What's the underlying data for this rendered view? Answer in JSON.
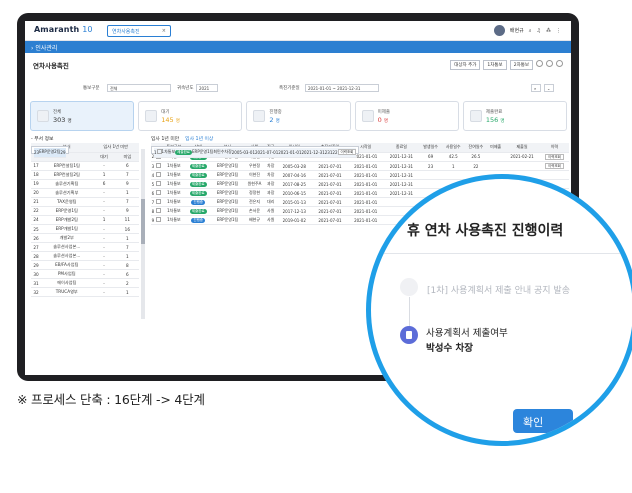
{
  "app": {
    "logo": "Amaranth",
    "version": "10",
    "open_tab": "연차사용촉진",
    "user_name": "배현규"
  },
  "nav": {
    "section": "인사관리"
  },
  "page": {
    "title": "연차사용촉진",
    "buttons": [
      "대상자 추가",
      "1차통보",
      "2차통보"
    ]
  },
  "filter": {
    "org_label": "통보구분",
    "org_value": "전체",
    "year_label": "귀속년도",
    "year_value": "2021",
    "period_label": "촉진기준일",
    "period_value": "2021-01-01 ~ 2021-12-31"
  },
  "cards": [
    {
      "label": "전체",
      "value": "303",
      "unit": "명",
      "color": "#333333"
    },
    {
      "label": "대기",
      "value": "145",
      "unit": "명",
      "color": "#e8a317"
    },
    {
      "label": "진행중",
      "value": "2",
      "unit": "명",
      "color": "#2a7fd4"
    },
    {
      "label": "미제출",
      "value": "0",
      "unit": "명",
      "color": "#d93a3a"
    },
    {
      "label": "제출완료",
      "value": "156",
      "unit": "명",
      "color": "#27a86a"
    }
  ],
  "left_panel": {
    "title": "- 부서 정보",
    "headers": [
      "",
      "부서",
      "대기",
      "미입"
    ],
    "group_header": "입사 1년 미만",
    "rows": [
      [
        "17",
        "ERP컨설팅1팀",
        "-",
        "6"
      ],
      [
        "18",
        "ERP컨설팅2팀",
        "1",
        "7"
      ],
      [
        "19",
        "솔루션기획팀",
        "6",
        "9"
      ],
      [
        "20",
        "솔루션기획부",
        "-",
        "1"
      ],
      [
        "21",
        "TAX운영팀",
        "-",
        "7"
      ],
      [
        "22",
        "ERP운영1팀",
        "-",
        "9"
      ],
      [
        "23",
        "ERP운영2팀",
        "2",
        "9"
      ],
      [
        "24",
        "ERP개발2팀",
        "1",
        "11"
      ],
      [
        "25",
        "ERP개발1팀",
        "-",
        "16"
      ],
      [
        "26",
        "개발2부",
        "-",
        "1"
      ],
      [
        "27",
        "솔루션사업본...",
        "-",
        "7"
      ],
      [
        "28",
        "솔루션사업본...",
        "-",
        "1"
      ],
      [
        "29",
        "EB/FA사업팀",
        "-",
        "8"
      ],
      [
        "30",
        "PM사업팀",
        "-",
        "6"
      ],
      [
        "31",
        "에이사업팀",
        "-",
        "2"
      ],
      [
        "32",
        "TRUCA영부",
        "-",
        "1"
      ]
    ],
    "selected_index": 6
  },
  "right_panel": {
    "tab_a": "입사 1년 미만",
    "tab_b": "입사 1년 이상",
    "headers": [
      "",
      "",
      "통보구분",
      "상태",
      "부서",
      "사원",
      "직급",
      "입사일",
      "촉진기준일",
      "시작일",
      "종료일",
      "발생일수",
      "사용일수",
      "잔여일수",
      "미제출",
      "제출일",
      "이력"
    ],
    "rows": [
      [
        "1",
        "",
        "1차통보",
        "제출완료",
        "ERP운영1팀",
        "최민수",
        "차장",
        "2005-03-01",
        "2021-07-01",
        "2021-01-01",
        "2021-12-31",
        "23",
        "1",
        "22",
        "",
        "",
        "이력조회"
      ],
      [
        "2",
        "",
        "1차통보",
        "제출완료",
        "ERP운영1팀",
        "이현민",
        "차장",
        "2005-03-21",
        "2021-07-01",
        "2021-01-01",
        "2021-12-31",
        "69",
        "42.5",
        "26.5",
        "",
        "2021-02-21",
        "이력조회"
      ],
      [
        "3",
        "",
        "1차통보",
        "제출완료",
        "ERP운영1팀",
        "우현정",
        "차장",
        "2005-03-28",
        "2021-07-01",
        "2021-01-01",
        "2021-12-31",
        "23",
        "1",
        "22",
        "",
        "",
        "이력조회"
      ],
      [
        "4",
        "",
        "1차통보",
        "제출완료",
        "ERP운영1팀",
        "이현진",
        "차장",
        "2007-04-16",
        "2021-07-01",
        "2021-01-01",
        "2021-12-31",
        "",
        "",
        "",
        "",
        "",
        ""
      ],
      [
        "5",
        "",
        "1차통보",
        "제출완료",
        "ERP운영1팀",
        "원현주A",
        "과장",
        "2017-08-25",
        "2021-07-01",
        "2021-01-01",
        "2021-12-31",
        "",
        "",
        "",
        "",
        "",
        ""
      ],
      [
        "6",
        "",
        "1차통보",
        "제출완료",
        "ERP운영1팀",
        "정정현",
        "과장",
        "2010-06-15",
        "2021-07-01",
        "2021-01-01",
        "2021-12-31",
        "",
        "",
        "",
        "",
        "",
        ""
      ],
      [
        "7",
        "",
        "1차통보",
        "진행중",
        "ERP운영1팀",
        "전은지",
        "대리",
        "2015-01-13",
        "2021-07-01",
        "2021-01-01",
        "",
        "",
        "",
        "",
        "",
        "",
        ""
      ],
      [
        "8",
        "",
        "1차통보",
        "제출완료",
        "ERP운영1팀",
        "손서윤",
        "사원",
        "2017-12-13",
        "2021-07-01",
        "2021-01-01",
        "",
        "",
        "",
        "",
        "",
        "",
        ""
      ],
      [
        "9",
        "",
        "1차통보",
        "진행중",
        "ERP운영1팀",
        "배현규",
        "사원",
        "2019-01-02",
        "2021-07-01",
        "2021-01-01",
        "",
        "",
        "",
        "",
        "",
        "",
        ""
      ]
    ],
    "selected_index": 0
  },
  "popup": {
    "title": "휴 연차 사용촉진 진행이력",
    "item1": "[1차] 사용계획서 제출 안내 공지 발송",
    "item2_line1": "사용계획서 제출여부",
    "item2_line2": "박성수 차장",
    "confirm": "확인"
  },
  "caption": "※ 프로세스 단축 : 16단계 -> 4단계"
}
